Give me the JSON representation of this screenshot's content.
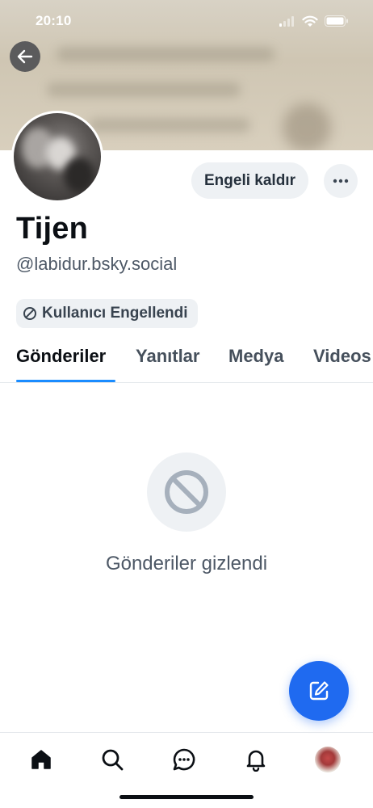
{
  "status_bar": {
    "time": "20:10"
  },
  "profile": {
    "display_name": "Tijen",
    "handle": "@labidur.bsky.social",
    "unblock_label": "Engeli kaldır",
    "more_label": "···",
    "blocked_badge_label": "Kullanıcı Engellendi"
  },
  "tabs": [
    {
      "label": "Gönderiler",
      "active": true
    },
    {
      "label": "Yanıtlar",
      "active": false
    },
    {
      "label": "Medya",
      "active": false
    },
    {
      "label": "Videos",
      "active": false
    }
  ],
  "empty_state": {
    "message": "Gönderiler gizlendi",
    "icon": "blocked-circle-icon"
  },
  "bottom_nav": {
    "items": [
      "home-icon",
      "search-icon",
      "chat-icon",
      "bell-icon",
      "profile-avatar"
    ]
  },
  "colors": {
    "accent": "#1a8cff",
    "fab": "#1f6af0",
    "muted_text": "#4d5866",
    "chip_bg": "#eef1f4"
  }
}
